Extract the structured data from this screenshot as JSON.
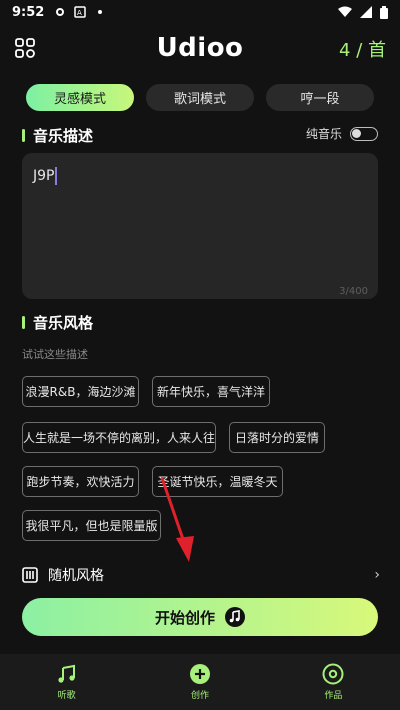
{
  "status": {
    "time": "9:52"
  },
  "header": {
    "title": "Udioo",
    "counter": "4 / 首"
  },
  "mode_tabs": [
    {
      "label": "灵感模式",
      "active": true
    },
    {
      "label": "歌词模式",
      "active": false
    },
    {
      "label": "哼一段",
      "active": false
    }
  ],
  "music_desc": {
    "title": "音乐描述",
    "pure_music_label": "纯音乐",
    "input_value": "J9P",
    "char_count": "3/400"
  },
  "music_style": {
    "title": "音乐风格",
    "hint": "试试这些描述",
    "chips": [
      "浪漫R&B，海边沙滩",
      "新年快乐，喜气洋洋",
      "人生就是一场不停的离别，人来人往",
      "日落时分的爱情",
      "跑步节奏，欢快活力",
      "圣诞节快乐，温暖冬天",
      "我很平凡，但也是限量版"
    ]
  },
  "random_style": {
    "label": "随机风格"
  },
  "create_button": {
    "label": "开始创作"
  },
  "bottom_nav": [
    {
      "label": "听歌",
      "icon": "music-note-icon"
    },
    {
      "label": "创作",
      "icon": "plus-circle-icon"
    },
    {
      "label": "作品",
      "icon": "disc-icon"
    }
  ],
  "colors": {
    "accent": "#a7f07a",
    "background": "#121212",
    "surface": "#262626"
  }
}
